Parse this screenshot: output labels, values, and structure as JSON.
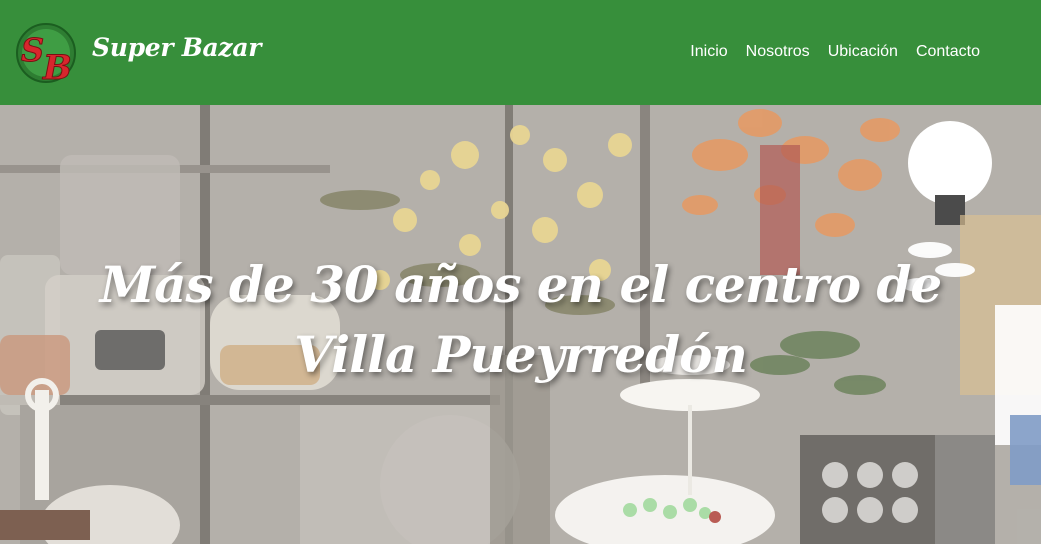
{
  "header": {
    "brand_name": "Super Bazar",
    "logo_icon": "sb-logo-icon",
    "colors": {
      "background": "#378f3b",
      "text": "#ffffff",
      "logo_red": "#d8262d",
      "logo_green": "#2e7d32"
    }
  },
  "nav": {
    "items": [
      {
        "label": "Inicio"
      },
      {
        "label": "Nosotros"
      },
      {
        "label": "Ubicación"
      },
      {
        "label": "Contacto"
      }
    ]
  },
  "hero": {
    "title": "Más de 30 años en el centro de Villa Pueyrredón"
  }
}
